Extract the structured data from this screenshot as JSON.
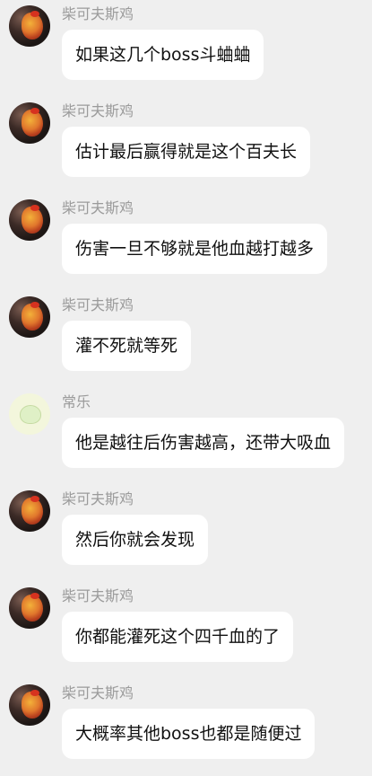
{
  "messages": [
    {
      "name": "柴可夫斯鸡",
      "avatar": "chicken-avatar",
      "text": "如果这几个boss斗蛐蛐"
    },
    {
      "name": "柴可夫斯鸡",
      "avatar": "chicken-avatar",
      "text": "估计最后赢得就是这个百夫长"
    },
    {
      "name": "柴可夫斯鸡",
      "avatar": "chicken-avatar",
      "text": "伤害一旦不够就是他血越打越多"
    },
    {
      "name": "柴可夫斯鸡",
      "avatar": "chicken-avatar",
      "text": "灌不死就等死"
    },
    {
      "name": "常乐",
      "avatar": "cat-avatar",
      "text": "他是越往后伤害越高，还带大吸血"
    },
    {
      "name": "柴可夫斯鸡",
      "avatar": "chicken-avatar",
      "text": "然后你就会发现"
    },
    {
      "name": "柴可夫斯鸡",
      "avatar": "chicken-avatar",
      "text": "你都能灌死这个四千血的了"
    },
    {
      "name": "柴可夫斯鸡",
      "avatar": "chicken-avatar",
      "text": "大概率其他boss也都是随便过"
    }
  ]
}
